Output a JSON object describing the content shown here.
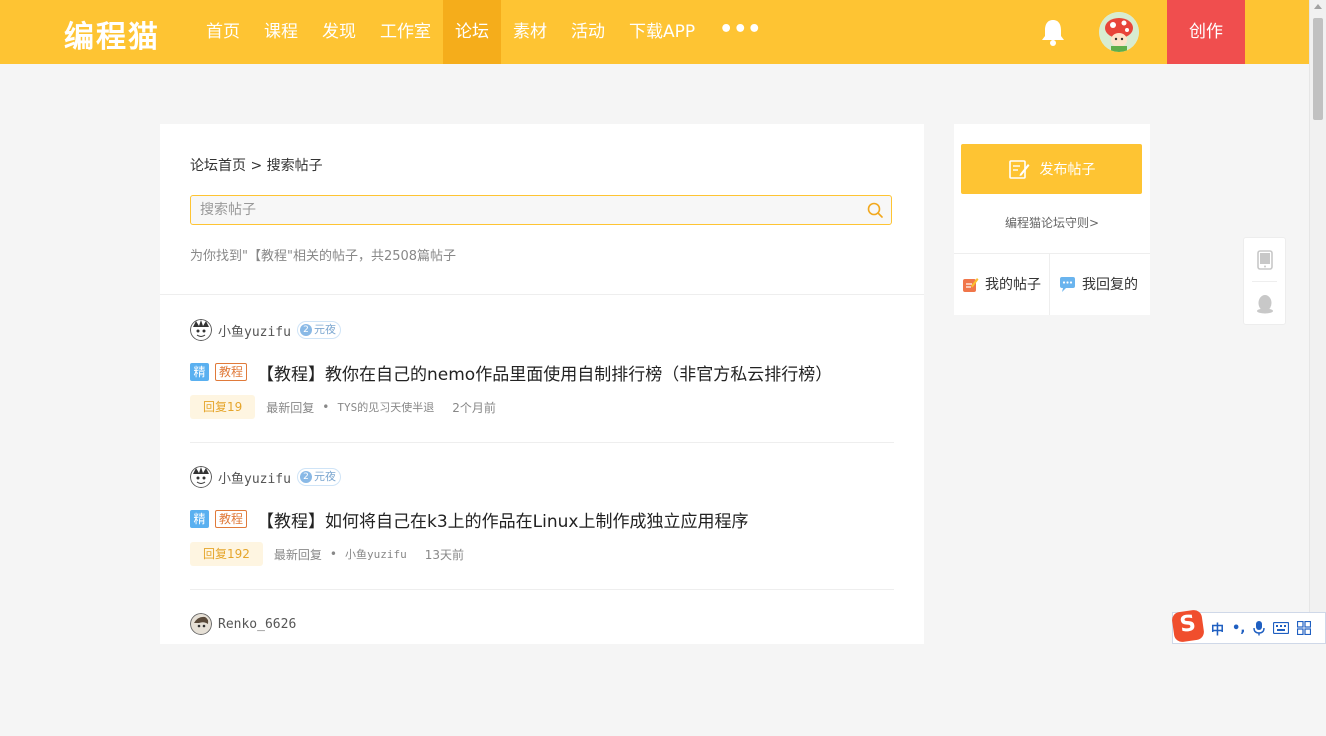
{
  "header": {
    "logo": "编程猫",
    "nav": [
      "首页",
      "课程",
      "发现",
      "工作室",
      "论坛",
      "素材",
      "活动",
      "下载APP"
    ],
    "nav_active": "论坛",
    "more": "•••",
    "create": "创作"
  },
  "breadcrumb": {
    "home": "论坛首页",
    "sep": " > ",
    "current": "搜索帖子"
  },
  "search": {
    "placeholder": "搜索帖子",
    "value": ""
  },
  "result_summary": "为你找到\"【教程\"相关的帖子，共2508篇帖子",
  "posts": [
    {
      "user": "小鱼yuzifu",
      "badge_level": "2",
      "badge_text": "元夜",
      "tag_featured": "精",
      "tag_category": "教程",
      "title": "【教程】教你在自己的nemo作品里面使用自制排行榜（非官方私云排行榜）",
      "reply": "回复19",
      "latest_label": "最新回复",
      "dot": "•",
      "latest_user": "TYS的见习天使半退",
      "time": "2个月前"
    },
    {
      "user": "小鱼yuzifu",
      "badge_level": "2",
      "badge_text": "元夜",
      "tag_featured": "精",
      "tag_category": "教程",
      "title": "【教程】如何将自己在k3上的作品在Linux上制作成独立应用程序",
      "reply": "回复192",
      "latest_label": "最新回复",
      "dot": "•",
      "latest_user": "小鱼yuzifu",
      "time": "13天前"
    },
    {
      "user": "Renko_6626"
    }
  ],
  "sidebar": {
    "publish": "发布帖子",
    "rules": "编程猫论坛守则>",
    "my_posts": "我的帖子",
    "my_replies": "我回复的"
  },
  "ime": {
    "logo": "S",
    "lang": "中",
    "punct": "•,",
    "mic": "mic-icon",
    "keyboard": "keyboard-icon",
    "grid": "grid-icon"
  },
  "colors": {
    "brand": "#fec433",
    "brand_active": "#f5ad1b",
    "create": "#f04e4e",
    "featured": "#5ab0f0",
    "category": "#e07a3a"
  }
}
